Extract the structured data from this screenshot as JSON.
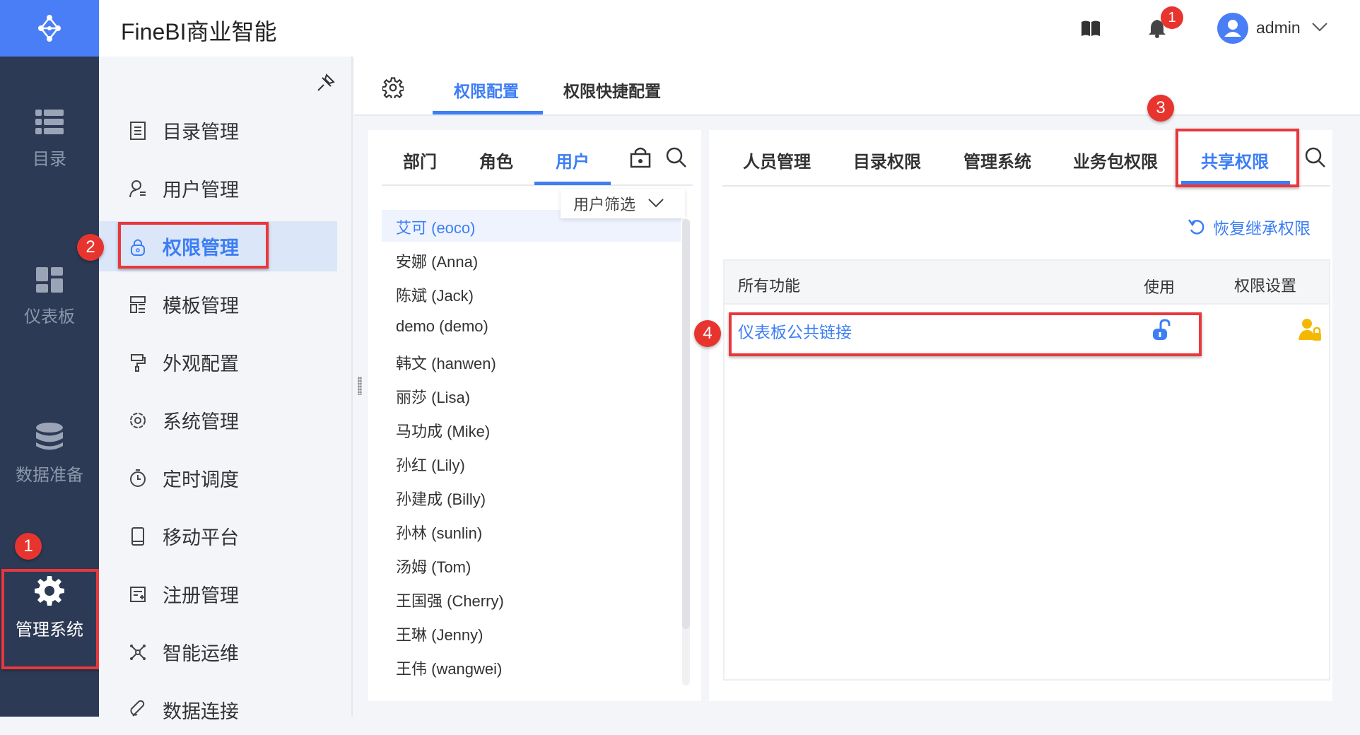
{
  "app": {
    "title": "FineBI商业智能",
    "user": "admin",
    "notification_count": "1"
  },
  "rail": [
    {
      "label": "目录",
      "icon": "list-icon"
    },
    {
      "label": "仪表板",
      "icon": "dashboard-icon"
    },
    {
      "label": "数据准备",
      "icon": "database-icon"
    },
    {
      "label": "管理系统",
      "icon": "gear-icon",
      "active": true
    }
  ],
  "sidebar": {
    "items": [
      {
        "label": "目录管理"
      },
      {
        "label": "用户管理"
      },
      {
        "label": "权限管理",
        "active": true
      },
      {
        "label": "模板管理"
      },
      {
        "label": "外观配置"
      },
      {
        "label": "系统管理"
      },
      {
        "label": "定时调度"
      },
      {
        "label": "移动平台"
      },
      {
        "label": "注册管理"
      },
      {
        "label": "智能运维"
      },
      {
        "label": "数据连接"
      }
    ]
  },
  "top_tabs": [
    {
      "label": "权限配置",
      "active": true
    },
    {
      "label": "权限快捷配置"
    }
  ],
  "left_tabs": [
    {
      "label": "部门"
    },
    {
      "label": "角色"
    },
    {
      "label": "用户",
      "active": true
    }
  ],
  "user_filter": "用户筛选",
  "users": [
    "艾可 (eoco)",
    "安娜 (Anna)",
    "陈斌 (Jack)",
    "demo (demo)",
    "韩文 (hanwen)",
    "丽莎 (Lisa)",
    "马功成 (Mike)",
    "孙红 (Lily)",
    "孙建成 (Billy)",
    "孙林 (sunlin)",
    "汤姆 (Tom)",
    "王国强 (Cherry)",
    "王琳 (Jenny)",
    "王伟 (wangwei)"
  ],
  "right_tabs": [
    {
      "label": "人员管理"
    },
    {
      "label": "目录权限"
    },
    {
      "label": "管理系统"
    },
    {
      "label": "业务包权限"
    },
    {
      "label": "共享权限",
      "active": true
    }
  ],
  "restore_label": "恢复继承权限",
  "table": {
    "headers": [
      "所有功能",
      "使用",
      "权限设置"
    ],
    "rows": [
      {
        "name": "仪表板公共链接",
        "use": "unlocked"
      }
    ]
  },
  "annotations": [
    "1",
    "2",
    "3",
    "4"
  ],
  "colors": {
    "accent": "#3d7ef5",
    "rail": "#2c3a55",
    "logo": "#4a7ef6",
    "annotation": "#e8342f",
    "warning": "#f5b800"
  }
}
